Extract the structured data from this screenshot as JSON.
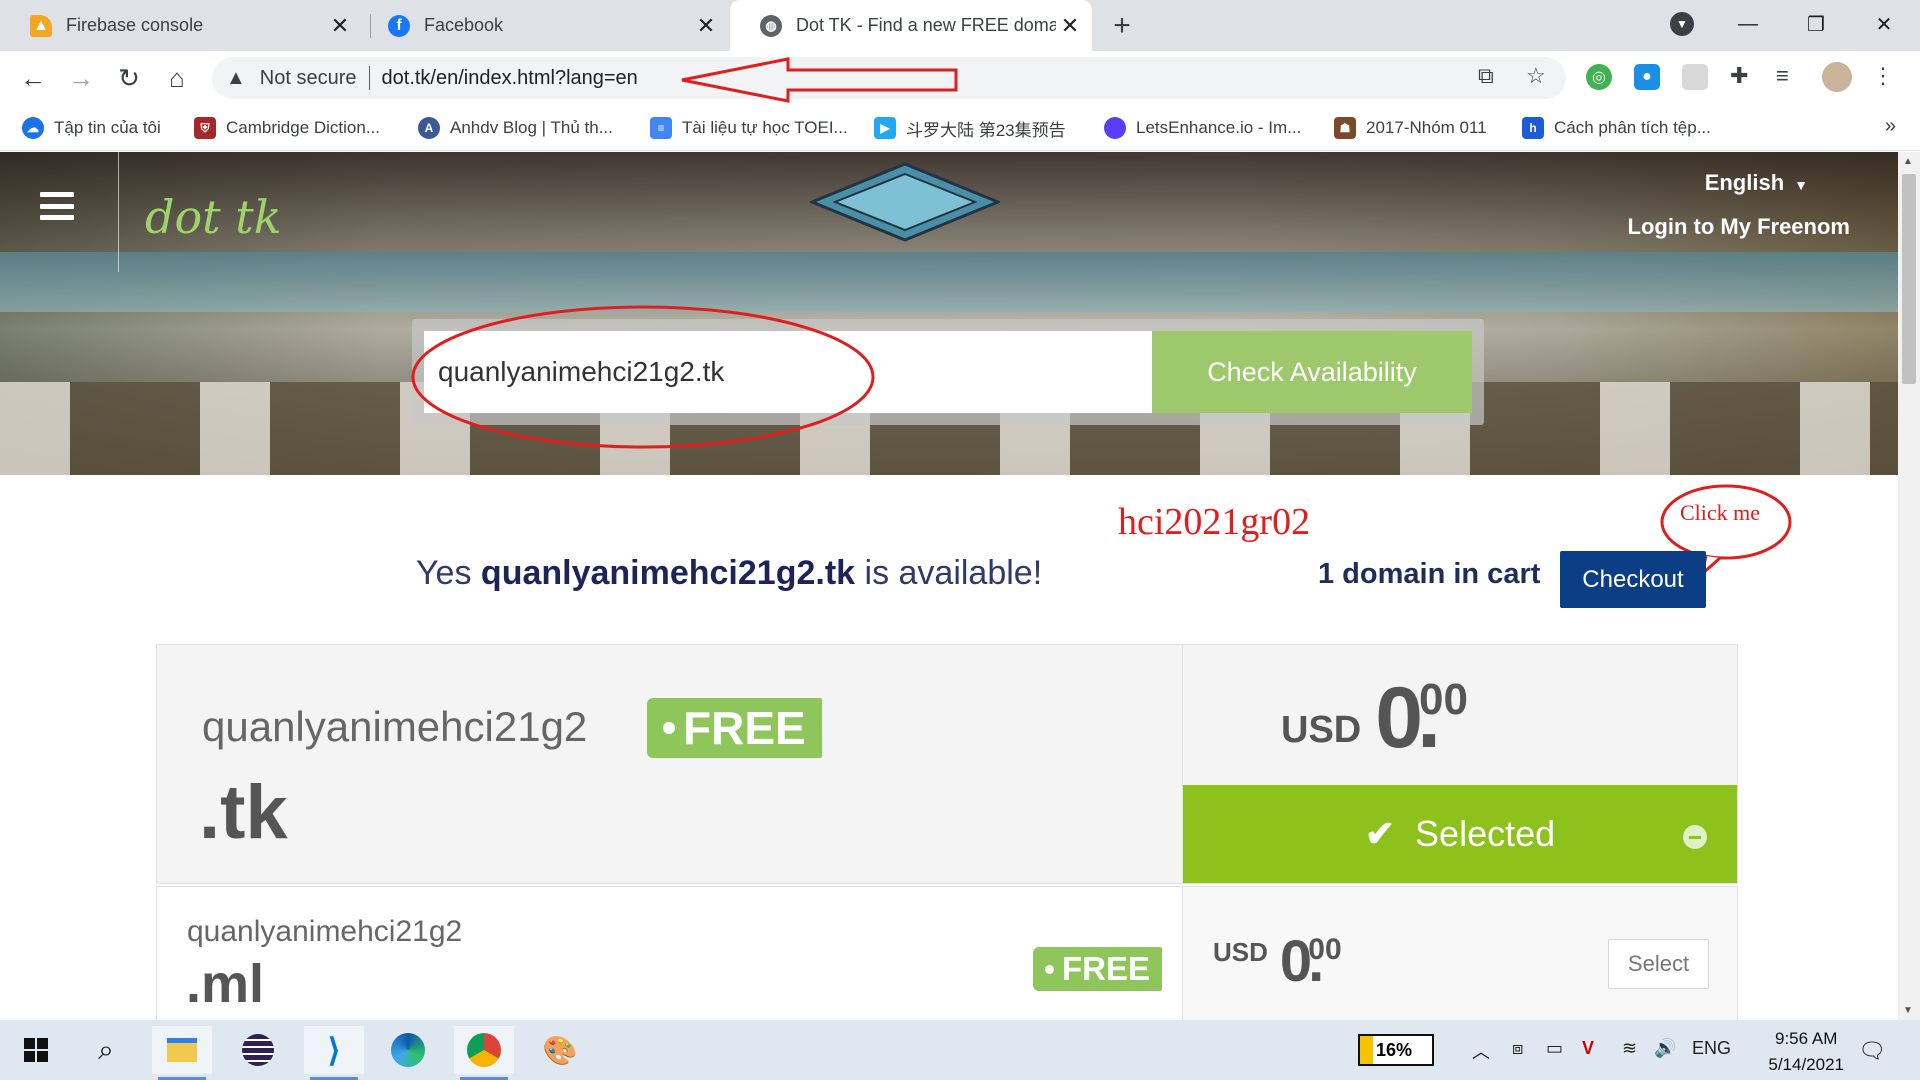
{
  "browser": {
    "tabs": [
      {
        "title": "Firebase console",
        "icon": "firebase-icon",
        "color": "#f5a623"
      },
      {
        "title": "Facebook",
        "icon": "facebook-icon",
        "color": "#1877f2"
      },
      {
        "title": "Dot TK - Find a new FREE domain",
        "icon": "globe-icon",
        "color": "#5f6368"
      }
    ],
    "address": {
      "security": "Not secure",
      "url": "dot.tk/en/index.html?lang=en"
    },
    "bookmarks": [
      {
        "label": "Tập tin của tôi",
        "color": "#1a73e8"
      },
      {
        "label": "Cambridge Diction...",
        "color": "#a4282b"
      },
      {
        "label": "Anhdv Blog | Thủ th...",
        "color": "#3b5998"
      },
      {
        "label": "Tài liệu tự học TOEI...",
        "color": "#4285f4"
      },
      {
        "label": "斗罗大陆 第23集预告",
        "color": "#22a7f0"
      },
      {
        "label": "LetsEnhance.io - Im...",
        "color": "#5b3df5"
      },
      {
        "label": "2017-Nhóm 011",
        "color": "#7a4a2a"
      },
      {
        "label": "Cách phân tích tệp...",
        "color": "#1e5bd6"
      }
    ],
    "bookmarks_more": "»"
  },
  "site": {
    "language": "English",
    "login": "Login to My Freenom",
    "logo": "dot tk",
    "search_value": "quanlyanimehci21g2.tk",
    "check_button": "Check Availability",
    "availability": {
      "prefix": "Yes ",
      "domain": "quanlyanimehci21g2.tk",
      "suffix": " is available!"
    },
    "cart": "1 domain in cart",
    "checkout": "Checkout",
    "results": [
      {
        "name": "quanlyanimehci21g2",
        "tld": ".tk",
        "badge": "FREE",
        "currency": "USD",
        "price_int": "0",
        "price_cents": "00",
        "action": "Selected"
      },
      {
        "name": "quanlyanimehci21g2",
        "tld": ".ml",
        "badge": "FREE",
        "currency": "USD",
        "price_int": "0",
        "price_cents": "00",
        "action": "Select"
      }
    ]
  },
  "annotations": {
    "user_label": "hci2021gr02",
    "callout": "Click me"
  },
  "taskbar": {
    "battery": "16%",
    "language": "ENG",
    "time": "9:56 AM",
    "date": "5/14/2021"
  },
  "colors": {
    "accent_green": "#8dc11c",
    "badge_green": "#8fc65b",
    "checkout_blue": "#0b3e84",
    "annotation_red": "#e01e1e"
  }
}
